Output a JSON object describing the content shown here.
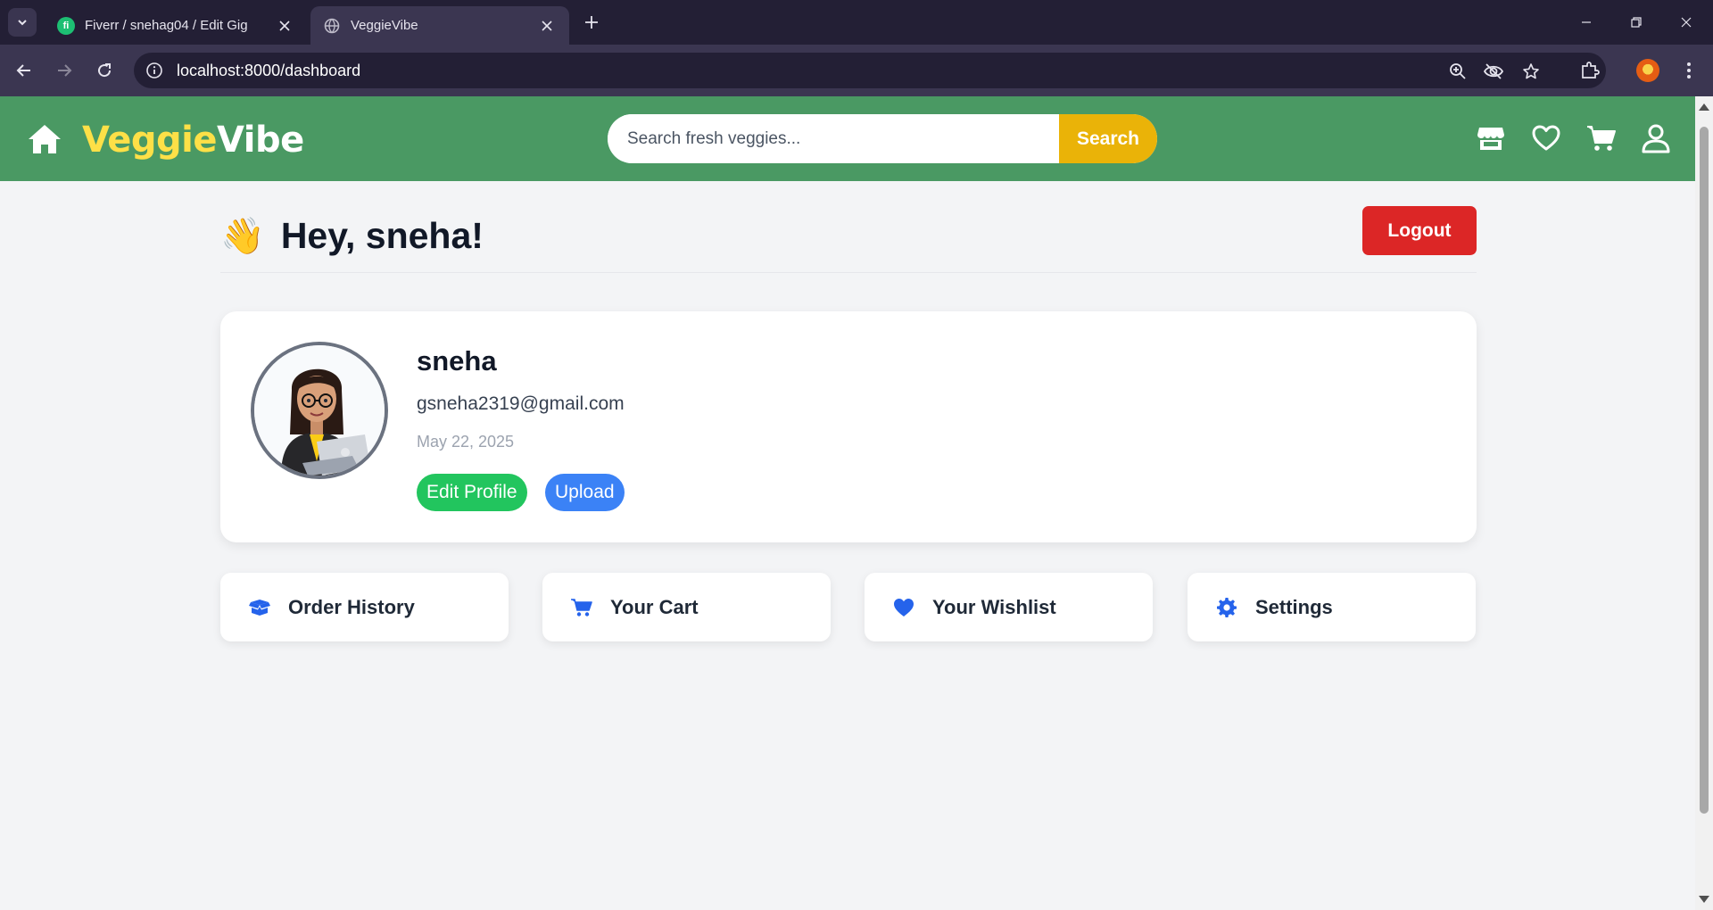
{
  "browser": {
    "tabs": [
      {
        "title": "Fiverr / snehag04 / Edit Gig",
        "favicon": "fiverr-icon",
        "active": false
      },
      {
        "title": "VeggieVibe",
        "favicon": "globe-icon",
        "active": true
      }
    ],
    "url": "localhost:8000/dashboard"
  },
  "header": {
    "logo_part1": "Veggie",
    "logo_part2": "Vibe",
    "search_placeholder": "Search fresh veggies...",
    "search_button": "Search",
    "icons": [
      "store-icon",
      "heart-icon",
      "cart-icon",
      "user-icon"
    ]
  },
  "greeting": {
    "emoji": "👋",
    "text": "Hey, sneha!",
    "logout_label": "Logout"
  },
  "profile": {
    "name": "sneha",
    "email": "gsneha2319@gmail.com",
    "date": "May 22, 2025",
    "edit_label": "Edit Profile",
    "upload_label": "Upload"
  },
  "tiles": [
    {
      "label": "Order History",
      "icon": "box-icon"
    },
    {
      "label": "Your Cart",
      "icon": "cart-icon"
    },
    {
      "label": "Your Wishlist",
      "icon": "heart-icon"
    },
    {
      "label": "Settings",
      "icon": "gear-icon"
    }
  ],
  "colors": {
    "header_green": "#4a9963",
    "logo_yellow": "#fde047",
    "search_button": "#eab308",
    "logout_red": "#dc2626",
    "edit_green": "#22c55e",
    "upload_blue": "#3b82f6",
    "tile_icon_blue": "#2563eb"
  }
}
